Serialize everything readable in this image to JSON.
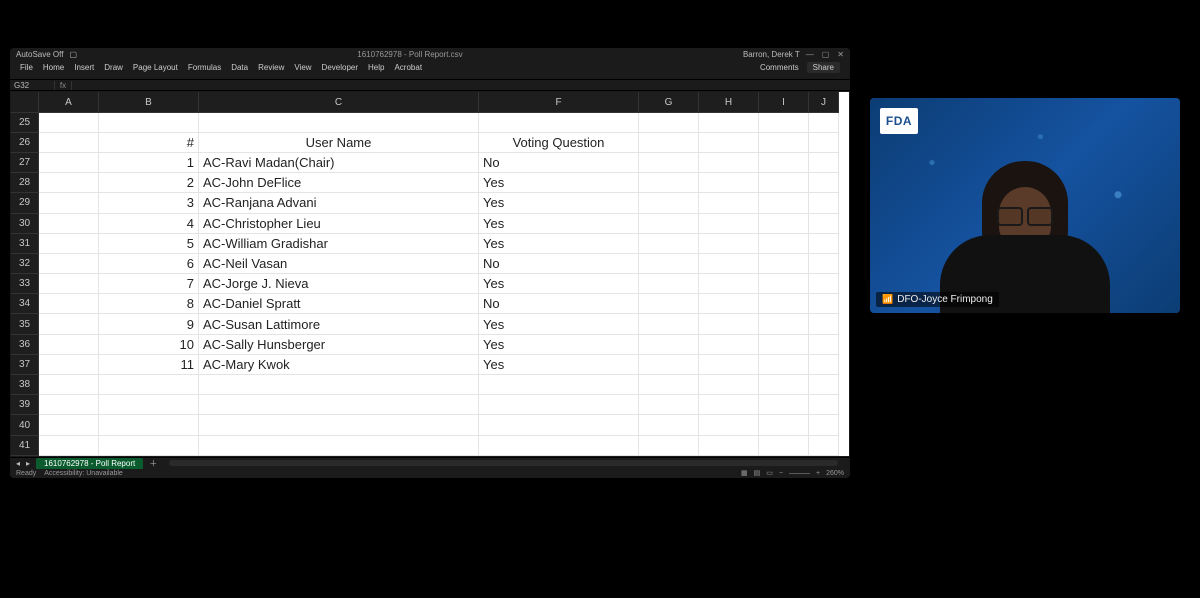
{
  "excel": {
    "autoSave": "AutoSave  Off",
    "documentTitle": "1610762978 - Poll Report.csv",
    "userName": "Barron, Derek T",
    "menuTabs": [
      "File",
      "Home",
      "Insert",
      "Draw",
      "Page Layout",
      "Formulas",
      "Data",
      "Review",
      "View",
      "Developer",
      "Help",
      "Acrobat"
    ],
    "commentsLabel": "Comments",
    "shareLabel": "Share",
    "nameBox": "G32",
    "columns": [
      "A",
      "B",
      "C",
      "F",
      "G",
      "H",
      "I",
      "J"
    ],
    "startRow": 25,
    "endRow": 41,
    "headerRow": 26,
    "sheetTab": "1610762978 - Poll Report",
    "statusReady": "Ready",
    "statusAccessibility": "Accessibility: Unavailable",
    "zoom": "260%",
    "headers": {
      "num": "#",
      "user": "User Name",
      "vote": "Voting Question"
    },
    "rows": [
      {
        "n": 1,
        "user": "AC-Ravi  Madan(Chair)",
        "vote": "No"
      },
      {
        "n": 2,
        "user": "AC-John DeFlice",
        "vote": "Yes"
      },
      {
        "n": 3,
        "user": "AC-Ranjana Advani",
        "vote": "Yes"
      },
      {
        "n": 4,
        "user": "AC-Christopher Lieu",
        "vote": "Yes"
      },
      {
        "n": 5,
        "user": "AC-William Gradishar",
        "vote": "Yes"
      },
      {
        "n": 6,
        "user": "AC-Neil Vasan",
        "vote": "No"
      },
      {
        "n": 7,
        "user": "AC-Jorge J.  Nieva",
        "vote": "Yes"
      },
      {
        "n": 8,
        "user": "AC-Daniel Spratt",
        "vote": "No"
      },
      {
        "n": 9,
        "user": "AC-Susan Lattimore",
        "vote": "Yes"
      },
      {
        "n": 10,
        "user": "AC-Sally Hunsberger",
        "vote": "Yes"
      },
      {
        "n": 11,
        "user": "AC-Mary Kwok",
        "vote": "Yes"
      }
    ]
  },
  "webcam": {
    "badge": "FDA",
    "name": "DFO-Joyce Frimpong"
  }
}
